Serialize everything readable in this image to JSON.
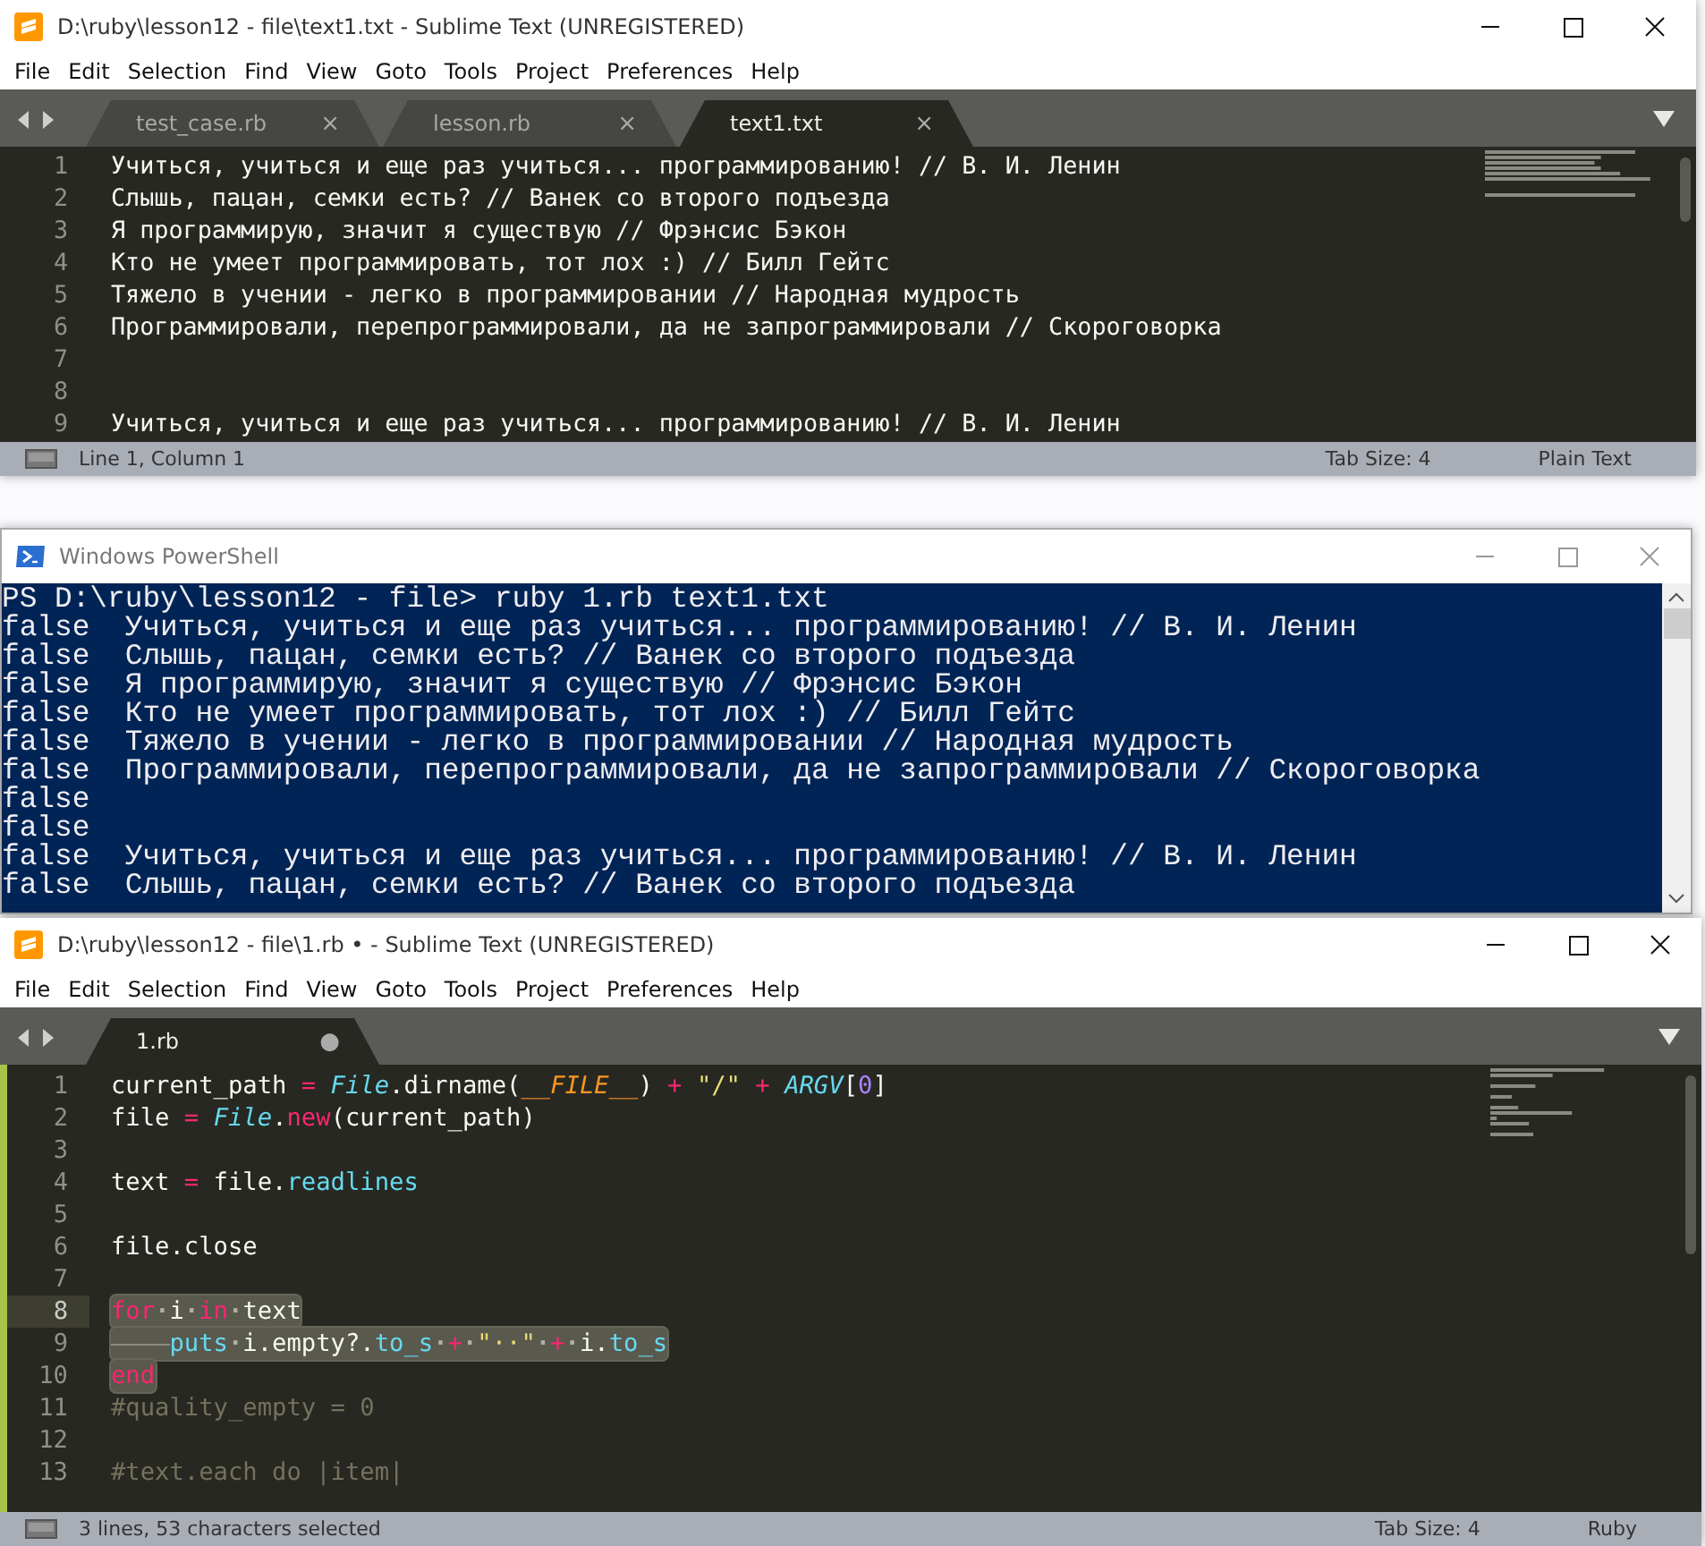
{
  "sublime_top": {
    "title": "D:\\ruby\\lesson12 - file\\text1.txt - Sublime Text (UNREGISTERED)",
    "menu": [
      "File",
      "Edit",
      "Selection",
      "Find",
      "View",
      "Goto",
      "Tools",
      "Project",
      "Preferences",
      "Help"
    ],
    "tabs": [
      {
        "label": "test_case.rb",
        "selected": false,
        "marker": "×"
      },
      {
        "label": "lesson.rb",
        "selected": false,
        "marker": "×"
      },
      {
        "label": "text1.txt",
        "selected": true,
        "marker": "×"
      }
    ],
    "lines": [
      {
        "number": "1",
        "tokens": [
          {
            "text": "Учиться, учиться и еще раз учиться... программированию! // В. И. Ленин",
            "kind": "plain"
          }
        ]
      },
      {
        "number": "2",
        "tokens": [
          {
            "text": "Слышь, пацан, семки есть? // Ванек со второго подъезда",
            "kind": "plain"
          }
        ]
      },
      {
        "number": "3",
        "tokens": [
          {
            "text": "Я программирую, значит я существую // Фрэнсис Бэкон",
            "kind": "plain"
          }
        ]
      },
      {
        "number": "4",
        "tokens": [
          {
            "text": "Кто не умеет программировать, тот лох :) // Билл Гейтс",
            "kind": "plain"
          }
        ]
      },
      {
        "number": "5",
        "tokens": [
          {
            "text": "Тяжело в учении - легко в программировании // Народная мудрость",
            "kind": "plain"
          }
        ]
      },
      {
        "number": "6",
        "tokens": [
          {
            "text": "Программировали, перепрограммировали, да не запрограммировали // Скороговорка",
            "kind": "plain"
          }
        ]
      },
      {
        "number": "7"
      },
      {
        "number": "8"
      },
      {
        "number": "9",
        "tokens": [
          {
            "text": "Учиться, учиться и еще раз учиться... программированию! // В. И. Ленин",
            "kind": "plain"
          }
        ]
      }
    ],
    "status": {
      "position": "Line 1, Column 1",
      "tab_size": "Tab Size: 4",
      "syntax": "Plain Text"
    }
  },
  "powershell": {
    "title": "Windows PowerShell",
    "lines": [
      "PS D:\\ruby\\lesson12 - file> ruby 1.rb text1.txt",
      "false  Учиться, учиться и еще раз учиться... программированию! // В. И. Ленин",
      "false  Слышь, пацан, семки есть? // Ванек со второго подъезда",
      "false  Я программирую, значит я существую // Фрэнсис Бэкон",
      "false  Кто не умеет программировать, тот лох :) // Билл Гейтс",
      "false  Тяжело в учении - легко в программировании // Народная мудрость",
      "false  Программировали, перепрограммировали, да не запрограммировали // Скороговорка",
      "false",
      "false",
      "false  Учиться, учиться и еще раз учиться... программированию! // В. И. Ленин",
      "false  Слышь, пацан, семки есть? // Ванек со второго подъезда"
    ]
  },
  "sublime_bottom": {
    "title": "D:\\ruby\\lesson12 - file\\1.rb • - Sublime Text (UNREGISTERED)",
    "menu": [
      "File",
      "Edit",
      "Selection",
      "Find",
      "View",
      "Goto",
      "Tools",
      "Project",
      "Preferences",
      "Help"
    ],
    "tabs": [
      {
        "label": "1.rb",
        "selected": true,
        "marker": "●"
      }
    ],
    "lines": [
      {
        "number": "1",
        "selected": false,
        "current": false,
        "tokens": [
          {
            "text": "current_path",
            "kind": "plain"
          },
          {
            "text": " = ",
            "kind": "op"
          },
          {
            "text": "File",
            "kind": "class"
          },
          {
            "text": ".dirname(",
            "kind": "plain"
          },
          {
            "text": "__FILE__",
            "kind": "const"
          },
          {
            "text": ")",
            "kind": "plain"
          },
          {
            "text": " + ",
            "kind": "op"
          },
          {
            "text": "\"/\"",
            "kind": "string"
          },
          {
            "text": " + ",
            "kind": "op"
          },
          {
            "text": "ARGV",
            "kind": "class"
          },
          {
            "text": "[",
            "kind": "plain"
          },
          {
            "text": "0",
            "kind": "number"
          },
          {
            "text": "]",
            "kind": "plain"
          }
        ]
      },
      {
        "number": "2",
        "selected": false,
        "current": false,
        "tokens": [
          {
            "text": "file",
            "kind": "plain"
          },
          {
            "text": " = ",
            "kind": "op"
          },
          {
            "text": "File",
            "kind": "class"
          },
          {
            "text": ".",
            "kind": "plain"
          },
          {
            "text": "new",
            "kind": "op"
          },
          {
            "text": "(current_path)",
            "kind": "plain"
          }
        ]
      },
      {
        "number": "3",
        "selected": false,
        "current": false
      },
      {
        "number": "4",
        "selected": false,
        "current": false,
        "tokens": [
          {
            "text": "text ",
            "kind": "plain"
          },
          {
            "text": "=",
            "kind": "op"
          },
          {
            "text": " file.",
            "kind": "plain"
          },
          {
            "text": "readlines",
            "kind": "func"
          }
        ]
      },
      {
        "number": "5",
        "selected": false,
        "current": false
      },
      {
        "number": "6",
        "selected": false,
        "current": false,
        "tokens": [
          {
            "text": "file.close",
            "kind": "plain"
          }
        ]
      },
      {
        "number": "7",
        "selected": false,
        "current": false
      },
      {
        "number": "8",
        "selected": true,
        "current": true,
        "tokens": [
          {
            "text": "for",
            "kind": "op"
          },
          {
            "text": "·",
            "kind": "ws"
          },
          {
            "text": "i",
            "kind": "plain"
          },
          {
            "text": "·",
            "kind": "ws"
          },
          {
            "text": "in",
            "kind": "op"
          },
          {
            "text": "·",
            "kind": "ws"
          },
          {
            "text": "text",
            "kind": "plain"
          }
        ]
      },
      {
        "number": "9",
        "selected": true,
        "current": false,
        "tokens": [
          {
            "kind": "tab"
          },
          {
            "text": "puts",
            "kind": "func"
          },
          {
            "text": "·",
            "kind": "ws"
          },
          {
            "text": "i.empty?.",
            "kind": "plain"
          },
          {
            "text": "to_s",
            "kind": "func"
          },
          {
            "text": "·",
            "kind": "ws"
          },
          {
            "text": "+",
            "kind": "op"
          },
          {
            "text": "·",
            "kind": "ws"
          },
          {
            "text": "\"··\"",
            "kind": "string"
          },
          {
            "text": "·",
            "kind": "ws"
          },
          {
            "text": "+",
            "kind": "op"
          },
          {
            "text": "·",
            "kind": "ws"
          },
          {
            "text": "i.",
            "kind": "plain"
          },
          {
            "text": "to_s",
            "kind": "func"
          }
        ]
      },
      {
        "number": "10",
        "selected": true,
        "current": false,
        "tokens": [
          {
            "text": "end",
            "kind": "op"
          }
        ]
      },
      {
        "number": "11",
        "selected": false,
        "current": false,
        "tokens": [
          {
            "text": "#quality_empty = 0",
            "kind": "comment"
          }
        ]
      },
      {
        "number": "12",
        "selected": false,
        "current": false
      },
      {
        "number": "13",
        "selected": false,
        "current": false,
        "tokens": [
          {
            "text": "#text.each do |item|",
            "kind": "comment"
          }
        ]
      }
    ],
    "status": {
      "position": "3 lines, 53 characters selected",
      "tab_size": "Tab Size: 4",
      "syntax": "Ruby"
    }
  }
}
